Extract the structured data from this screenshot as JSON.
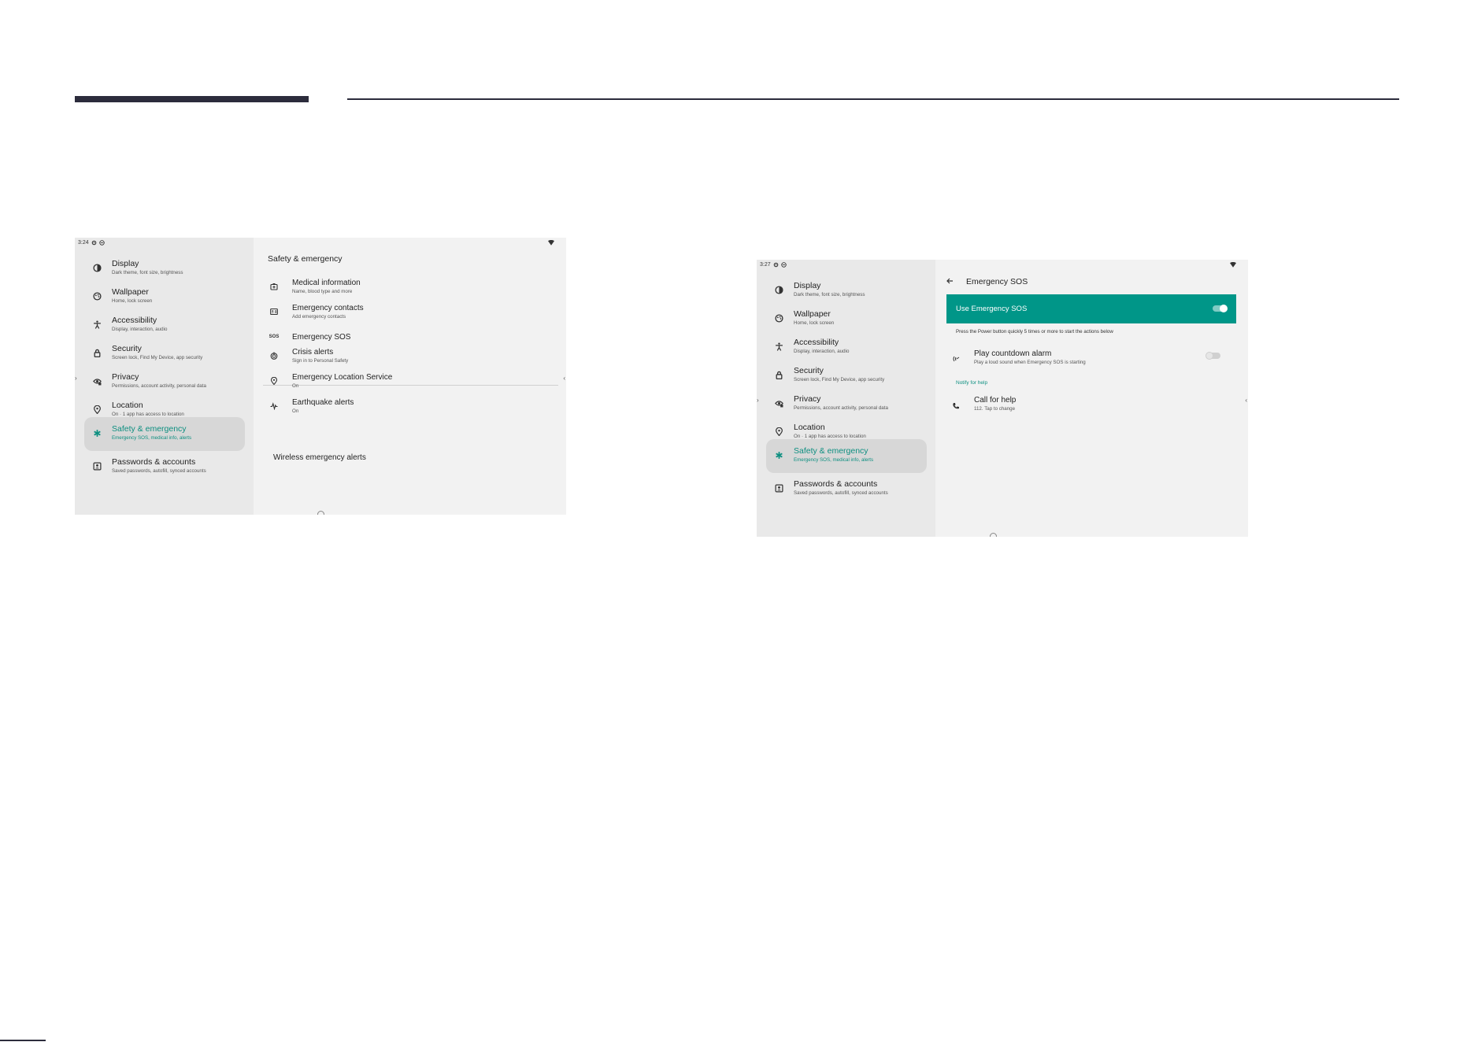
{
  "nav_items": [
    {
      "label": "Display",
      "sub": "Dark theme, font size, brightness",
      "icon": "brightness-icon"
    },
    {
      "label": "Wallpaper",
      "sub": "Home, lock screen",
      "icon": "palette-icon"
    },
    {
      "label": "Accessibility",
      "sub": "Display, interaction, audio",
      "icon": "accessibility-icon"
    },
    {
      "label": "Security",
      "sub": "Screen lock, Find My Device, app security",
      "icon": "lock-icon"
    },
    {
      "label": "Privacy",
      "sub": "Permissions, account activity, personal data",
      "icon": "privacy-icon"
    },
    {
      "label": "Location",
      "sub": "On · 1 app has access to location",
      "icon": "location-pin-icon"
    },
    {
      "label": "Safety & emergency",
      "sub": "Emergency SOS, medical info, alerts",
      "icon": "asterisk-icon"
    },
    {
      "label": "Passwords & accounts",
      "sub": "Saved passwords, autofill, synced accounts",
      "icon": "account-box-icon"
    }
  ],
  "left": {
    "time": "3:24",
    "title": "Safety & emergency",
    "items": [
      {
        "label": "Medical information",
        "sub": "Name, blood type and more",
        "icon": "medical-id-icon"
      },
      {
        "label": "Emergency contacts",
        "sub": "Add emergency contacts",
        "icon": "contacts-card-icon"
      },
      {
        "label": "Emergency SOS",
        "sub": "",
        "icon": "sos-icon",
        "glyph": "SOS"
      },
      {
        "label": "Crisis alerts",
        "sub": "Sign in to Personal Safety",
        "icon": "crisis-alert-icon"
      },
      {
        "label": "Emergency Location Service",
        "sub": "On",
        "icon": "location-pin-icon"
      },
      {
        "label": "Earthquake alerts",
        "sub": "On",
        "icon": "earthquake-icon"
      }
    ],
    "wireless": "Wireless emergency alerts"
  },
  "right": {
    "time": "3:27",
    "title": "Emergency SOS",
    "use_label": "Use Emergency SOS",
    "use_enabled": true,
    "help_text": "Press the Power button quickly 5 times or more to start the actions below",
    "countdown": {
      "label": "Play countdown alarm",
      "sub": "Play a loud sound when Emergency SOS is starting",
      "enabled": false
    },
    "section": "Notify for help",
    "call": {
      "label": "Call for help",
      "sub": "112. Tap to change"
    }
  },
  "colors": {
    "accent": "#009688",
    "active_text": "#0d8f80",
    "header": "#2c2c3c"
  }
}
